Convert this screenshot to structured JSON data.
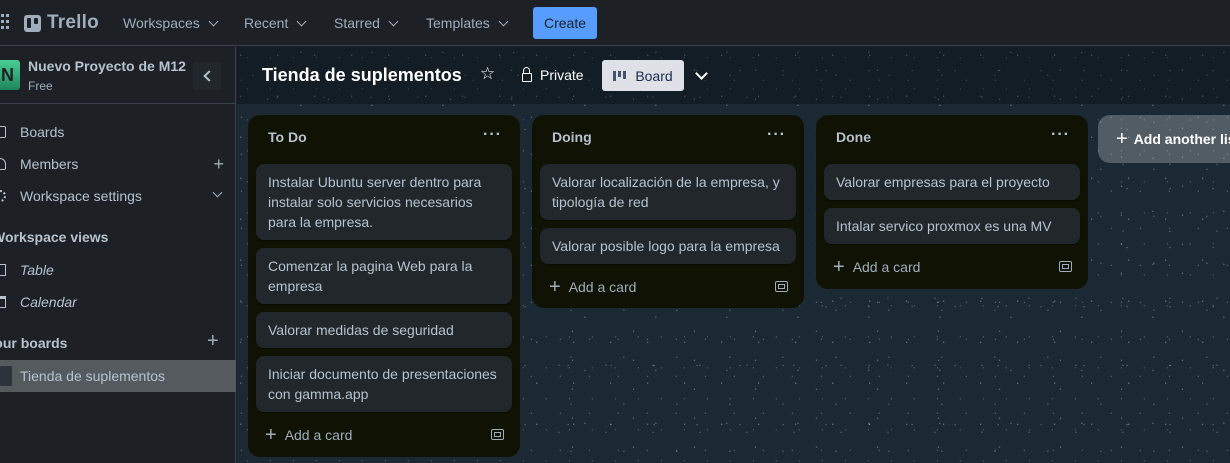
{
  "topbar": {
    "logo": "Trello",
    "nav": [
      "Workspaces",
      "Recent",
      "Starred",
      "Templates"
    ],
    "create_label": "Create"
  },
  "sidebar": {
    "workspace_initial": "N",
    "workspace_name": "Nuevo Proyecto de M12",
    "workspace_plan": "Free",
    "items": [
      {
        "label": "Boards"
      },
      {
        "label": "Members"
      },
      {
        "label": "Workspace settings"
      }
    ],
    "views_heading": "Workspace views",
    "views": [
      {
        "label": "Table"
      },
      {
        "label": "Calendar"
      }
    ],
    "your_boards_heading": "Your boards",
    "boards": [
      {
        "label": "Tienda de suplementos"
      }
    ]
  },
  "board": {
    "title": "Tienda de suplementos",
    "visibility": "Private",
    "view_label": "Board",
    "add_list_label": "Add another list",
    "lists": [
      {
        "title": "To Do",
        "cards": [
          "Instalar Ubuntu server dentro para instalar solo servicios necesarios para la empresa.",
          "Comenzar la pagina Web para la empresa",
          "Valorar medidas de seguridad",
          "Iniciar documento de presentaciones con gamma.app"
        ],
        "add_card": "Add a card"
      },
      {
        "title": "Doing",
        "cards": [
          "Valorar localización de la empresa, y tipología de red",
          "Valorar posible logo para la empresa"
        ],
        "add_card": "Add a card"
      },
      {
        "title": "Done",
        "cards": [
          "Valorar empresas para el proyecto",
          "Intalar servico proxmox es una MV"
        ],
        "add_card": "Add a card"
      }
    ]
  },
  "icons": {
    "apps": "grid-icon",
    "star": "star-icon",
    "lock": "lock-icon",
    "list_menu": "ellipsis-icon",
    "template": "card-template-icon"
  },
  "colors": {
    "create_button": "#579dff",
    "list_background": "#101204",
    "card_background": "#22272b",
    "workspace_avatar": "#4bce97"
  }
}
